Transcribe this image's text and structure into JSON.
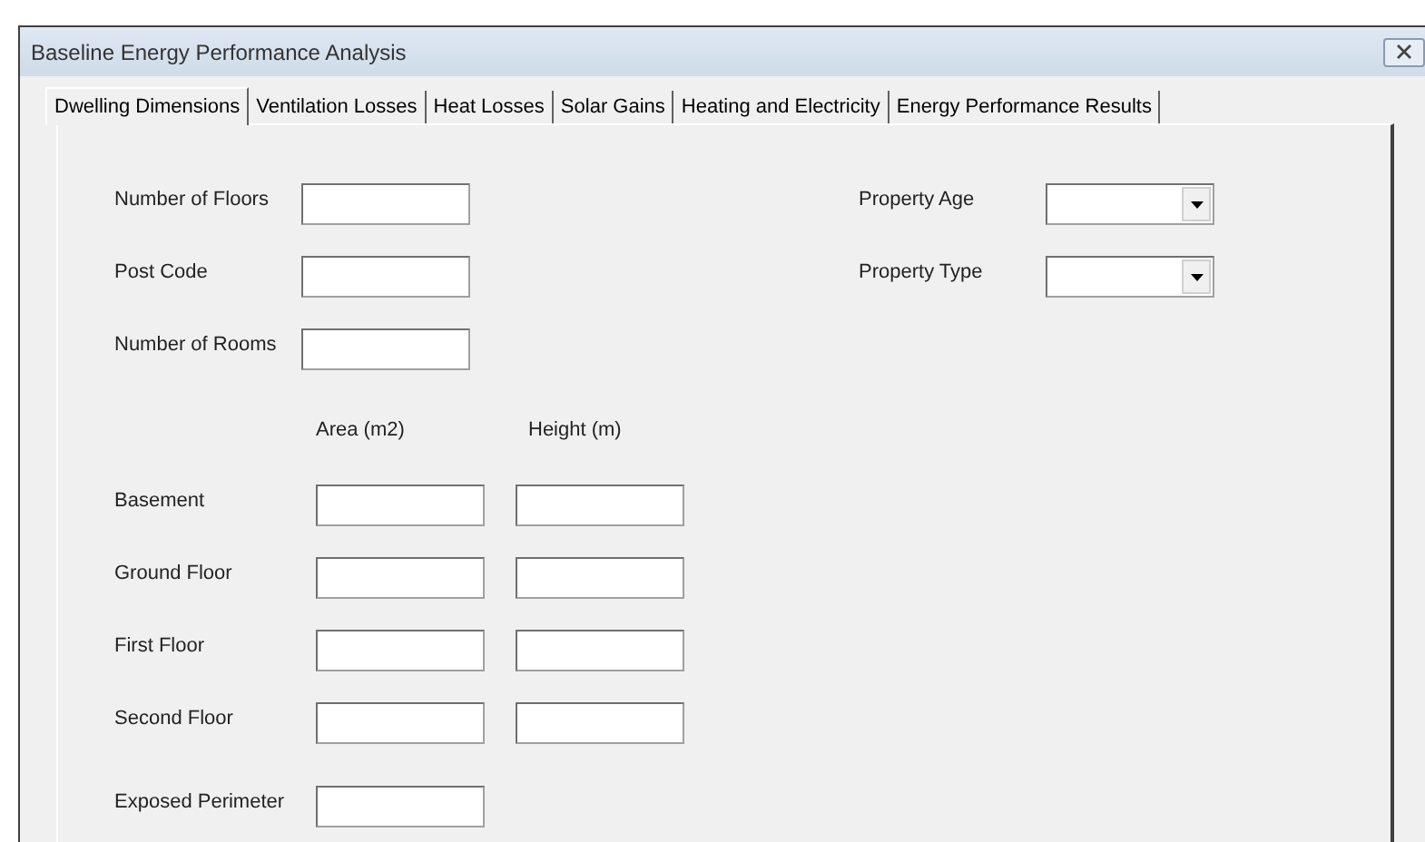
{
  "window": {
    "title": "Baseline Energy Performance Analysis"
  },
  "tabs": [
    {
      "label": "Dwelling Dimensions",
      "selected": true
    },
    {
      "label": "Ventilation Losses",
      "selected": false
    },
    {
      "label": "Heat Losses",
      "selected": false
    },
    {
      "label": "Solar Gains",
      "selected": false
    },
    {
      "label": "Heating and Electricity",
      "selected": false
    },
    {
      "label": "Energy Performance Results",
      "selected": false
    }
  ],
  "general_fields": [
    {
      "label": "Number of Floors"
    },
    {
      "label": "Post Code"
    },
    {
      "label": "Number of Rooms"
    }
  ],
  "property_dropdowns": [
    {
      "label": "Property Age"
    },
    {
      "label": "Property Type"
    }
  ],
  "floors_table": {
    "columns": [
      "Area (m2)",
      "Height (m)"
    ],
    "rows": [
      {
        "label": "Basement"
      },
      {
        "label": "Ground Floor"
      },
      {
        "label": "First Floor"
      },
      {
        "label": "Second Floor"
      }
    ]
  },
  "perimeter_field": {
    "label": "Exposed Perimeter"
  }
}
